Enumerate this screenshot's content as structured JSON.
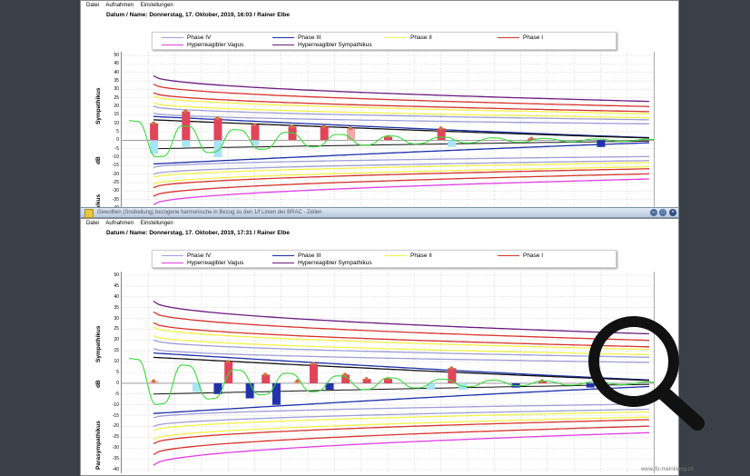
{
  "menu": [
    "Datei",
    "Aufnahmen",
    "Einstellungen"
  ],
  "window_title": "Gewollten (Snobeilung) bezogene harmonische in Bezug zu den 1/f Linien der BRAC - Zellen",
  "header1": "Datum / Name:  Donnerstag, 17. Oktober, 2019, 16:03  /  Rainer Elbe",
  "header2": "Datum / Name:  Donnerstag, 17. Oktober, 2019, 17:31  /  Rainer Elbe",
  "legend": [
    {
      "label": "Phase IV",
      "color": "#9e9ed8"
    },
    {
      "label": "Phase III",
      "color": "#1a2fa8"
    },
    {
      "label": "Phase II",
      "color": "#f2f247"
    },
    {
      "label": "Phase I",
      "color": "#d8322b"
    },
    {
      "label": "Hyperreagibler Vagus",
      "color": "#e43ce6"
    },
    {
      "label": "Hyperreagibler Sympathikus",
      "color": "#6c1a80"
    }
  ],
  "ylabels": {
    "sympathikus": "Sympathikus",
    "db": "dB",
    "parasympathikus": "Parasympathikus",
    "parasym_trunc": "thikus"
  },
  "y_ticks": [
    "50",
    "45",
    "40",
    "35",
    "30",
    "25",
    "20",
    "15",
    "10",
    "5",
    "0",
    "-5",
    "-10",
    "-15",
    "-20",
    "-25",
    "-30",
    "-35",
    "-40"
  ],
  "watermark": "www.ifo-meinklang.ch",
  "colors": {
    "phase4": "#9e9ed8",
    "phase3": "#1a2fa8",
    "phase2": "#f2f247",
    "phase1": "#d8322b",
    "vagus": "#e43ce6",
    "sympathikus": "#6c1a80",
    "black": "#111111",
    "green": "#3cd83c",
    "bar_red": "#e0455a",
    "bar_blue": "#2233aa",
    "bar_cyan": "#a8e4f5",
    "bar_pink": "#f0a8a8"
  },
  "chart_data": [
    {
      "type": "line",
      "ylabel": "dB",
      "ylim": [
        -40,
        50
      ],
      "grid": true,
      "bars": [
        {
          "x": 0.06,
          "v": 10,
          "c": "bar_red"
        },
        {
          "x": 0.06,
          "v": -8,
          "c": "bar_cyan"
        },
        {
          "x": 0.12,
          "v": 17,
          "c": "bar_red"
        },
        {
          "x": 0.12,
          "v": -4,
          "c": "bar_cyan"
        },
        {
          "x": 0.18,
          "v": 13,
          "c": "bar_red"
        },
        {
          "x": 0.18,
          "v": -10,
          "c": "bar_cyan"
        },
        {
          "x": 0.25,
          "v": 9,
          "c": "bar_red"
        },
        {
          "x": 0.25,
          "v": -3,
          "c": "bar_cyan"
        },
        {
          "x": 0.32,
          "v": 8,
          "c": "bar_red"
        },
        {
          "x": 0.38,
          "v": 8,
          "c": "bar_red"
        },
        {
          "x": 0.43,
          "v": 7,
          "c": "bar_pink"
        },
        {
          "x": 0.5,
          "v": 2,
          "c": "bar_red"
        },
        {
          "x": 0.6,
          "v": 7,
          "c": "bar_red"
        },
        {
          "x": 0.62,
          "v": -4,
          "c": "bar_cyan"
        },
        {
          "x": 0.77,
          "v": 1,
          "c": "bar_red"
        },
        {
          "x": 0.9,
          "v": -4,
          "c": "bar_blue"
        }
      ]
    },
    {
      "type": "line",
      "ylabel": "dB",
      "ylim": [
        -40,
        50
      ],
      "grid": true,
      "bars": [
        {
          "x": 0.06,
          "v": 1,
          "c": "bar_pink"
        },
        {
          "x": 0.14,
          "v": -4,
          "c": "bar_cyan"
        },
        {
          "x": 0.18,
          "v": -5,
          "c": "bar_blue"
        },
        {
          "x": 0.2,
          "v": 10,
          "c": "bar_red"
        },
        {
          "x": 0.24,
          "v": -7,
          "c": "bar_blue"
        },
        {
          "x": 0.27,
          "v": 4,
          "c": "bar_red"
        },
        {
          "x": 0.29,
          "v": -10,
          "c": "bar_blue"
        },
        {
          "x": 0.33,
          "v": 1,
          "c": "bar_pink"
        },
        {
          "x": 0.36,
          "v": 9,
          "c": "bar_red"
        },
        {
          "x": 0.39,
          "v": -3,
          "c": "bar_blue"
        },
        {
          "x": 0.42,
          "v": 4,
          "c": "bar_red"
        },
        {
          "x": 0.46,
          "v": 2,
          "c": "bar_red"
        },
        {
          "x": 0.5,
          "v": 2,
          "c": "bar_red"
        },
        {
          "x": 0.58,
          "v": -3,
          "c": "bar_cyan"
        },
        {
          "x": 0.62,
          "v": 7,
          "c": "bar_red"
        },
        {
          "x": 0.64,
          "v": -3,
          "c": "bar_cyan"
        },
        {
          "x": 0.74,
          "v": -2,
          "c": "bar_blue"
        },
        {
          "x": 0.79,
          "v": 1,
          "c": "bar_red"
        },
        {
          "x": 0.88,
          "v": -2,
          "c": "bar_blue"
        }
      ]
    }
  ]
}
